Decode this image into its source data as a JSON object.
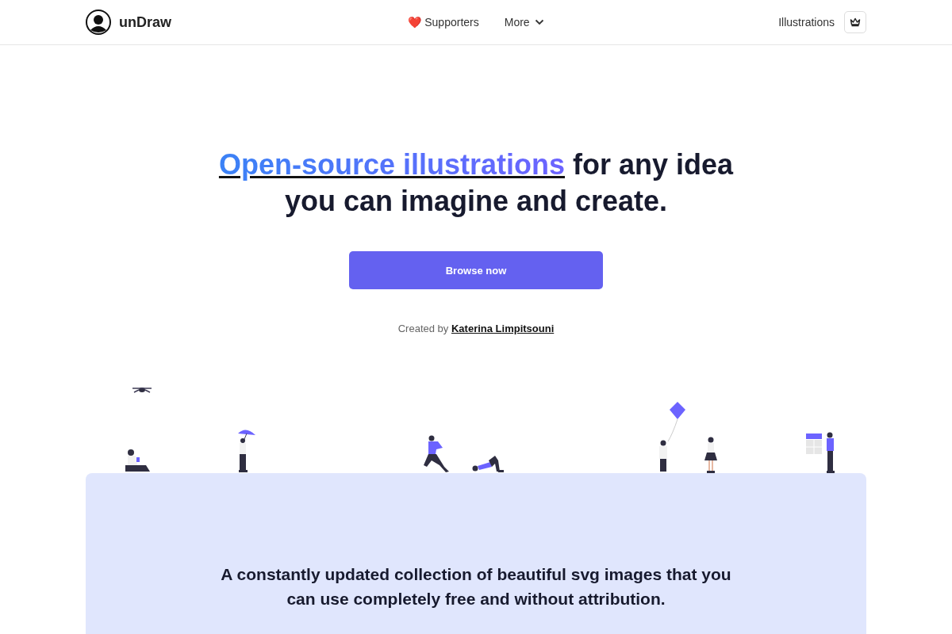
{
  "nav": {
    "brand": "unDraw",
    "links": [
      {
        "icon": "❤️",
        "label": "Supporters",
        "kind": "link"
      },
      {
        "label": "More",
        "kind": "dropdown"
      }
    ],
    "right_link": "Illustrations"
  },
  "hero": {
    "heading_link": "Open-source illustrations",
    "heading_rest": "for any idea",
    "heading_line_2": "you can imagine and create.",
    "button": "Browse now",
    "credit_prefix": "Created by",
    "credit_name": "Katerina Limpitsouni"
  },
  "panel": {
    "heading": "A constantly updated collection of beautiful svg images that you can use completely free and without attribution."
  }
}
